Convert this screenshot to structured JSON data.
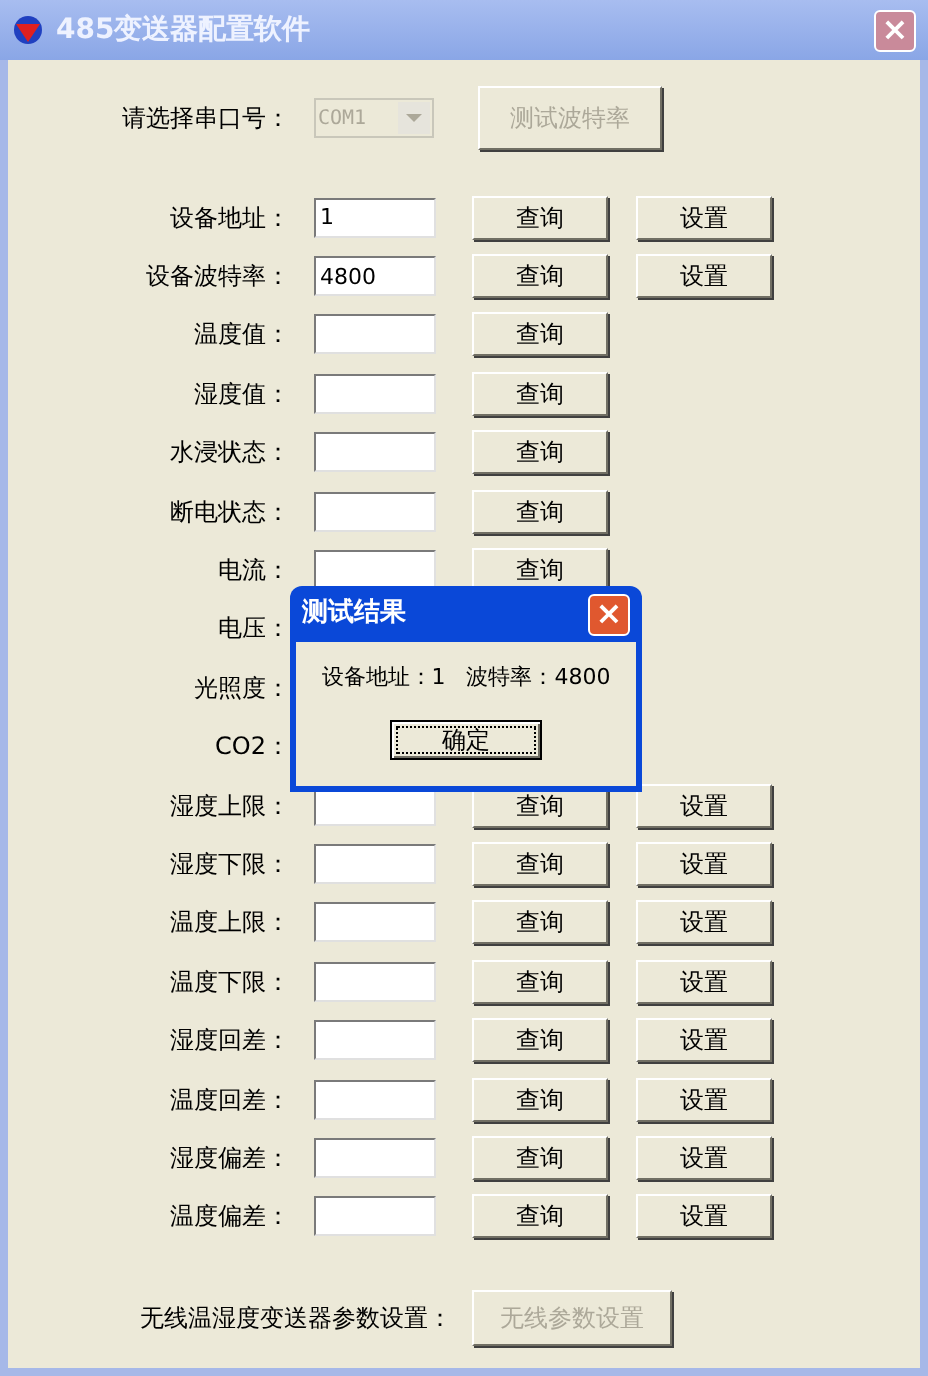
{
  "window": {
    "title": "485变送器配置软件",
    "close": "×"
  },
  "port": {
    "label": "请选择串口号：",
    "value": "COM1",
    "disabled": true,
    "test_button": {
      "label": "测试波特率",
      "disabled": true
    }
  },
  "rows": [
    {
      "label": "设备地址：",
      "field": true,
      "value": "1",
      "buttons": [
        "查询",
        "设置"
      ]
    },
    {
      "label": "设备波特率：",
      "field": true,
      "value": "4800",
      "buttons": [
        "查询",
        "设置"
      ]
    },
    {
      "label": "温度值：",
      "field": true,
      "buttons": [
        "查询"
      ]
    },
    {
      "label": "湿度值：",
      "field": true,
      "buttons": [
        "查询"
      ]
    },
    {
      "label": "水浸状态：",
      "field": true,
      "buttons": [
        "查询"
      ]
    },
    {
      "label": "断电状态：",
      "field": true,
      "buttons": [
        "查询"
      ]
    },
    {
      "label": "电流：",
      "field": true,
      "buttons": [
        "查询"
      ]
    },
    {
      "label": "电压：",
      "field": false,
      "buttons": []
    },
    {
      "label": "光照度：",
      "field": false,
      "buttons": []
    },
    {
      "label": "CO2：",
      "field": false,
      "buttons": []
    },
    {
      "label": "湿度上限：",
      "field": true,
      "buttons": [
        "查询",
        "设置"
      ]
    },
    {
      "label": "湿度下限：",
      "field": true,
      "buttons": [
        "查询",
        "设置"
      ]
    },
    {
      "label": "温度上限：",
      "field": true,
      "buttons": [
        "查询",
        "设置"
      ]
    },
    {
      "label": "温度下限：",
      "field": true,
      "buttons": [
        "查询",
        "设置"
      ]
    },
    {
      "label": "湿度回差：",
      "field": true,
      "buttons": [
        "查询",
        "设置"
      ]
    },
    {
      "label": "温度回差：",
      "field": true,
      "buttons": [
        "查询",
        "设置"
      ]
    },
    {
      "label": "湿度偏差：",
      "field": true,
      "buttons": [
        "查询",
        "设置"
      ]
    },
    {
      "label": "温度偏差：",
      "field": true,
      "buttons": [
        "查询",
        "设置"
      ]
    }
  ],
  "wireless": {
    "label": "无线温湿度变送器参数设置：",
    "button": {
      "label": "无线参数设置",
      "disabled": true
    }
  },
  "dialog": {
    "title": "测试结果",
    "close": "×",
    "message": "设备地址：1   波特率：4800",
    "ok_button": "确定"
  }
}
